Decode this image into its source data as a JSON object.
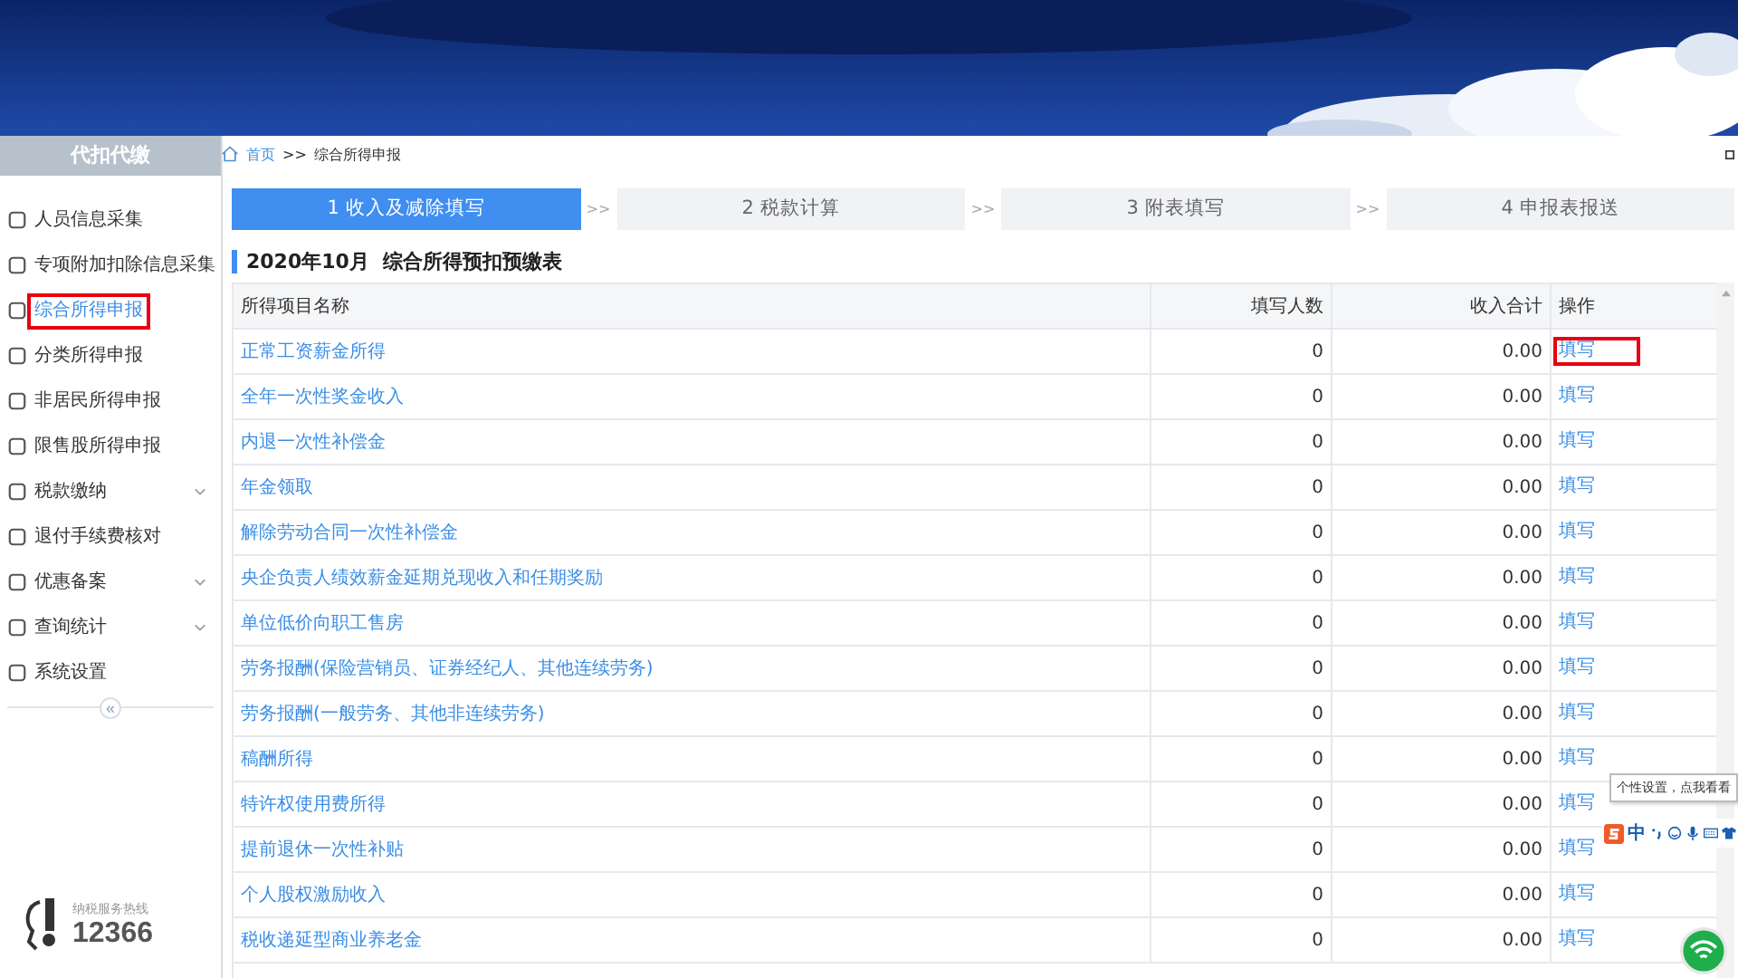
{
  "sidebar": {
    "title": "代扣代缴",
    "items": [
      {
        "label": "人员信息采集",
        "selected": false,
        "has_submenu": false,
        "highlighted": false
      },
      {
        "label": "专项附加扣除信息采集",
        "selected": false,
        "has_submenu": false,
        "highlighted": false
      },
      {
        "label": "综合所得申报",
        "selected": true,
        "has_submenu": false,
        "highlighted": true
      },
      {
        "label": "分类所得申报",
        "selected": false,
        "has_submenu": false,
        "highlighted": false
      },
      {
        "label": "非居民所得申报",
        "selected": false,
        "has_submenu": false,
        "highlighted": false
      },
      {
        "label": "限售股所得申报",
        "selected": false,
        "has_submenu": false,
        "highlighted": false
      },
      {
        "label": "税款缴纳",
        "selected": false,
        "has_submenu": true,
        "highlighted": false
      },
      {
        "label": "退付手续费核对",
        "selected": false,
        "has_submenu": false,
        "highlighted": false
      },
      {
        "label": "优惠备案",
        "selected": false,
        "has_submenu": true,
        "highlighted": false
      },
      {
        "label": "查询统计",
        "selected": false,
        "has_submenu": true,
        "highlighted": false
      },
      {
        "label": "系统设置",
        "selected": false,
        "has_submenu": false,
        "highlighted": false
      }
    ],
    "collapse": "«",
    "hotline_label": "纳税服务热线",
    "hotline_number": "12366"
  },
  "breadcrumb": {
    "home": "首页",
    "separator": ">>",
    "current": "综合所得申报"
  },
  "steps": [
    {
      "label": "1 收入及减除填写",
      "selected": true
    },
    {
      "label": "2 税款计算",
      "selected": false
    },
    {
      "label": "3 附表填写",
      "selected": false
    },
    {
      "label": "4 申报表报送",
      "selected": false
    }
  ],
  "step_separator": ">>",
  "section_title": "2020年10月  综合所得预扣预缴表",
  "table": {
    "columns": [
      "所得项目名称",
      "填写人数",
      "收入合计",
      "操作"
    ],
    "rows": [
      {
        "name": "正常工资薪金所得",
        "count": "0",
        "total": "0.00",
        "action": "填写",
        "highlighted": true
      },
      {
        "name": "全年一次性奖金收入",
        "count": "0",
        "total": "0.00",
        "action": "填写",
        "highlighted": false
      },
      {
        "name": "内退一次性补偿金",
        "count": "0",
        "total": "0.00",
        "action": "填写",
        "highlighted": false
      },
      {
        "name": "年金领取",
        "count": "0",
        "total": "0.00",
        "action": "填写",
        "highlighted": false
      },
      {
        "name": "解除劳动合同一次性补偿金",
        "count": "0",
        "total": "0.00",
        "action": "填写",
        "highlighted": false
      },
      {
        "name": "央企负责人绩效薪金延期兑现收入和任期奖励",
        "count": "0",
        "total": "0.00",
        "action": "填写",
        "highlighted": false
      },
      {
        "name": "单位低价向职工售房",
        "count": "0",
        "total": "0.00",
        "action": "填写",
        "highlighted": false
      },
      {
        "name": "劳务报酬(保险营销员、证券经纪人、其他连续劳务)",
        "count": "0",
        "total": "0.00",
        "action": "填写",
        "highlighted": false
      },
      {
        "name": "劳务报酬(一般劳务、其他非连续劳务)",
        "count": "0",
        "total": "0.00",
        "action": "填写",
        "highlighted": false
      },
      {
        "name": "稿酬所得",
        "count": "0",
        "total": "0.00",
        "action": "填写",
        "highlighted": false
      },
      {
        "name": "特许权使用费所得",
        "count": "0",
        "total": "0.00",
        "action": "填写",
        "highlighted": false
      },
      {
        "name": "提前退休一次性补贴",
        "count": "0",
        "total": "0.00",
        "action": "填写",
        "highlighted": false
      },
      {
        "name": "个人股权激励收入",
        "count": "0",
        "total": "0.00",
        "action": "填写",
        "highlighted": false
      },
      {
        "name": "税收递延型商业养老金",
        "count": "0",
        "total": "0.00",
        "action": "填写",
        "highlighted": false
      }
    ]
  },
  "ime": {
    "tooltip": "个性设置，点我看看",
    "mode": "中"
  }
}
